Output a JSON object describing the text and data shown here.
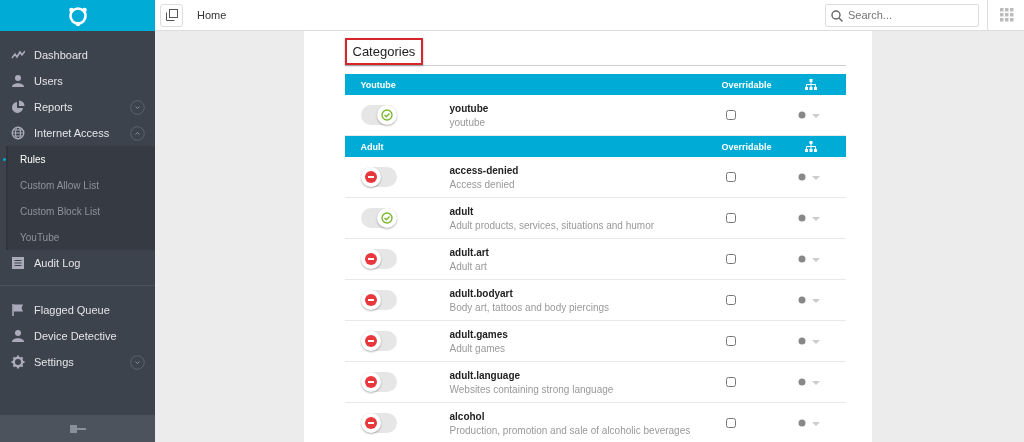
{
  "sidebar": {
    "items": [
      {
        "label": "Dashboard"
      },
      {
        "label": "Users"
      },
      {
        "label": "Reports",
        "expanded": false
      },
      {
        "label": "Internet Access",
        "expanded": true,
        "children": [
          {
            "label": "Rules",
            "selected": true
          },
          {
            "label": "Custom Allow List",
            "selected": false
          },
          {
            "label": "Custom Block List",
            "selected": false
          },
          {
            "label": "YouTube",
            "selected": false
          }
        ]
      },
      {
        "label": "Audit Log",
        "divider_after": true
      },
      {
        "label": "Flagged Queue"
      },
      {
        "label": "Device Detective"
      },
      {
        "label": "Settings",
        "expanded": false
      }
    ]
  },
  "topbar": {
    "breadcrumb": "Home",
    "search": {
      "placeholder": "Search..."
    }
  },
  "panel": {
    "title": "Categories",
    "highlighted": true,
    "groups": [
      {
        "name": "Youtube",
        "overridable_heading": "Overridable",
        "rows": [
          {
            "name": "youtube",
            "description": "youtube",
            "allowed": true,
            "overridable": false
          }
        ]
      },
      {
        "name": "Adult",
        "overridable_heading": "Overridable",
        "rows": [
          {
            "name": "access-denied",
            "description": "Access denied",
            "allowed": false,
            "overridable": false
          },
          {
            "name": "adult",
            "description": "Adult products, services, situations and humor",
            "allowed": true,
            "overridable": false
          },
          {
            "name": "adult.art",
            "description": "Adult art",
            "allowed": false,
            "overridable": false
          },
          {
            "name": "adult.bodyart",
            "description": "Body art, tattoos and body piercings",
            "allowed": false,
            "overridable": false
          },
          {
            "name": "adult.games",
            "description": "Adult games",
            "allowed": false,
            "overridable": false
          },
          {
            "name": "adult.language",
            "description": "Websites containing strong language",
            "allowed": false,
            "overridable": false
          },
          {
            "name": "alcohol",
            "description": "Production, promotion and sale of alcoholic beverages",
            "allowed": false,
            "overridable": false
          }
        ]
      }
    ]
  }
}
